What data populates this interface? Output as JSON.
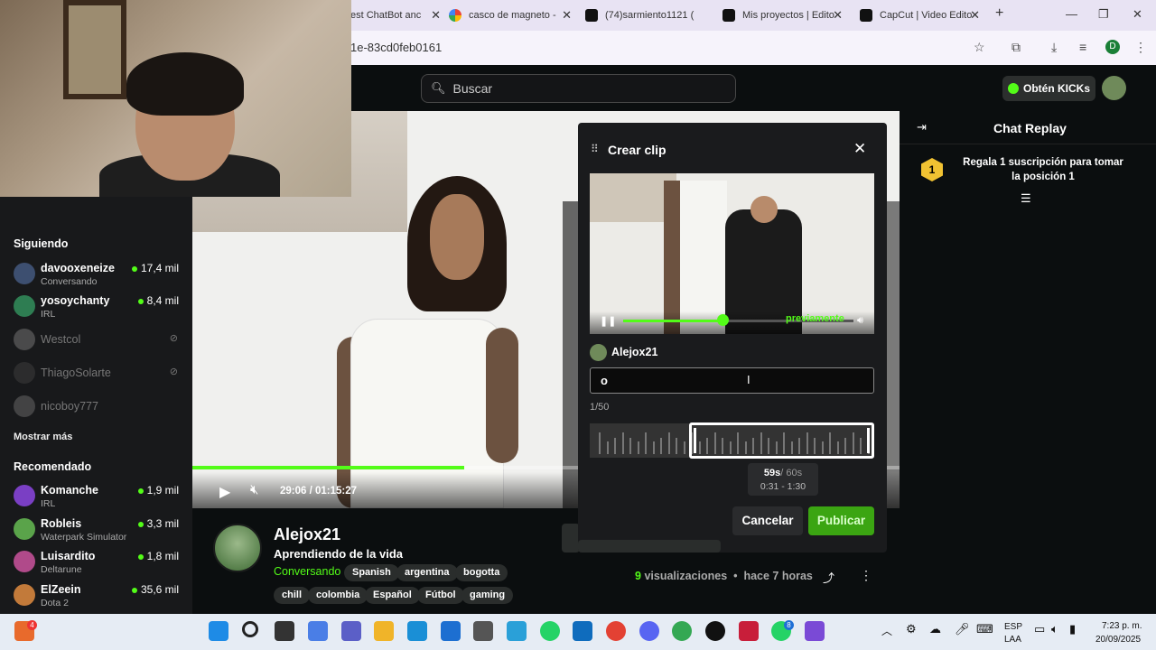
{
  "browser": {
    "tabs": [
      {
        "label": "est ChatBot anc",
        "icon": "chatbot-tab-icon",
        "color": "#ffffff"
      },
      {
        "label": "casco de magneto -",
        "icon": "google-tab-icon",
        "color": "#ffffff"
      },
      {
        "label": "(74)sarmiento1121 (",
        "icon": "tiktok-tab-icon",
        "color": "#111111"
      },
      {
        "label": "Mis proyectos | Edito",
        "icon": "capcut-tab-icon",
        "color": "#111111"
      },
      {
        "label": "CapCut | Video Edito",
        "icon": "capcut-tab-icon",
        "color": "#111111"
      }
    ],
    "new_tab": "+",
    "url": "1e-83cd0feb0161",
    "profile_letter": "D"
  },
  "header": {
    "search_placeholder": "Buscar",
    "kicks_label": "Obtén KICKs"
  },
  "sidebar": {
    "following_header_partial": "Siguiendo",
    "following_title": "Siguiendo",
    "following": [
      {
        "name": "davooxeneize",
        "sub": "Conversando",
        "count": "17,4 mil",
        "live": true,
        "color": "#3d4f70"
      },
      {
        "name": "yosoychanty",
        "sub": "IRL",
        "count": "8,4 mil",
        "live": true,
        "color": "#2e7d52"
      },
      {
        "name": "Westcol",
        "live": false,
        "color": "#888888"
      },
      {
        "name": "ThiagoSolarte",
        "live": false,
        "color": "#444444"
      },
      {
        "name": "nicoboy777",
        "live": false,
        "color": "#777777"
      }
    ],
    "show_more": "Mostrar más",
    "recommended_title": "Recomendado",
    "recommended": [
      {
        "name": "Komanche",
        "sub": "IRL",
        "count": "1,9 mil",
        "color": "#7a3fc4"
      },
      {
        "name": "Robleis",
        "sub": "Waterpark Simulator",
        "count": "3,3 mil",
        "color": "#5aa34a"
      },
      {
        "name": "Luisardito",
        "sub": "Deltarune",
        "count": "1,8 mil",
        "color": "#b04a8a"
      },
      {
        "name": "ElZeein",
        "sub": "Dota 2",
        "count": "35,6 mil",
        "color": "#c27a3a"
      }
    ]
  },
  "player": {
    "time": "29:06 / 01:15:27",
    "progress": 0.385
  },
  "channel": {
    "name": "Alejox21",
    "title": "Aprendiendo de la vida",
    "category": "Conversando",
    "tags_row1": [
      "Spanish",
      "argentina",
      "bogotta"
    ],
    "tags_row2": [
      "chill",
      "colombia",
      "Español",
      "Fútbol",
      "gaming"
    ],
    "views_count": "9",
    "views_label": "visualizaciones",
    "posted": "hace 7 horas"
  },
  "chat": {
    "title": "Chat Replay",
    "badge_number": "1",
    "sub_message": "Regala 1 suscripción para tomar la posición 1"
  },
  "clip_modal": {
    "title": "Crear clip",
    "preview_progress": 0.43,
    "preview_watermark": "previamente",
    "username": "Alejox21",
    "input_value": "o",
    "char_count": "1/50",
    "selected_duration": "59s",
    "max_duration": "/ 60s",
    "range": "0:31 - 1:30",
    "cancel_label": "Cancelar",
    "publish_label": "Publicar"
  },
  "taskbar": {
    "lang": "ESP",
    "region": "LAA",
    "time": "7:23 p. m.",
    "date": "20/09/2025",
    "notif_badge": "4",
    "whatsapp_badge": "8"
  },
  "colors": {
    "accent": "#53fc18",
    "publish": "#3ba512",
    "background": "#0b0e0f"
  }
}
